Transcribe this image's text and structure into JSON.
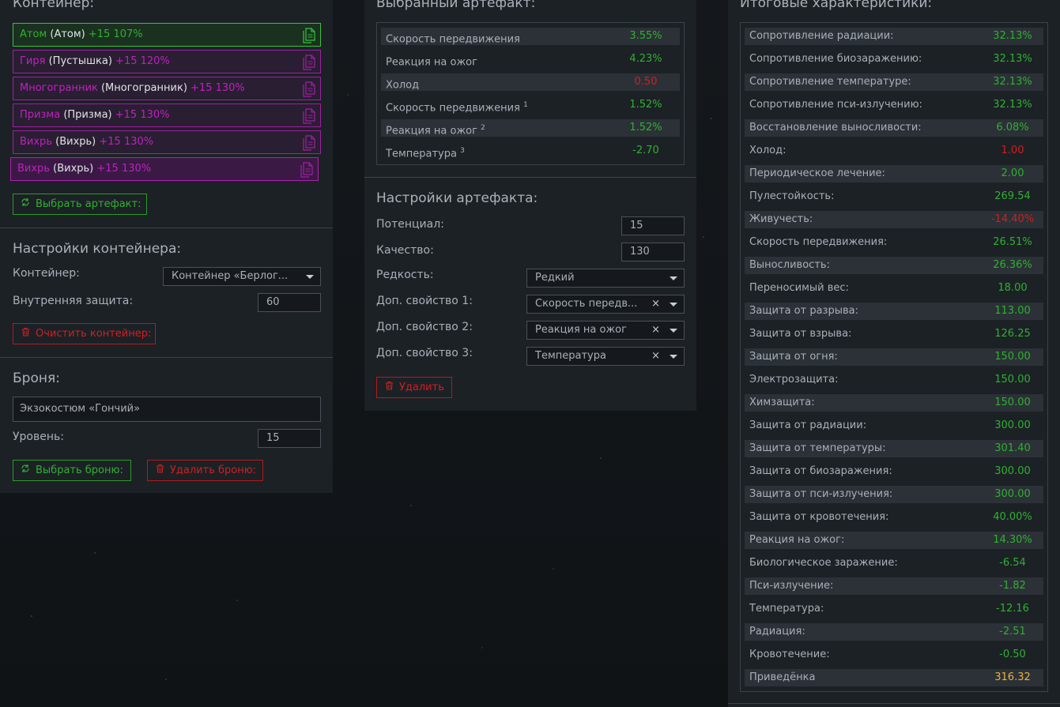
{
  "container_panel": {
    "title": "Контейнер:",
    "slots": [
      {
        "name": "Атом",
        "alias": "(Атом)",
        "bonus": "+15 107%",
        "rarity": "common"
      },
      {
        "name": "Гиря",
        "alias": "(Пустышка)",
        "bonus": "+15 120%",
        "rarity": "rare"
      },
      {
        "name": "Многогранник",
        "alias": "(Многогранник)",
        "bonus": "+15 130%",
        "rarity": "rare"
      },
      {
        "name": "Призма",
        "alias": "(Призма)",
        "bonus": "+15 130%",
        "rarity": "rare"
      },
      {
        "name": "Вихрь",
        "alias": "(Вихрь)",
        "bonus": "+15 130%",
        "rarity": "rare"
      },
      {
        "name": "Вихрь",
        "alias": "(Вихрь)",
        "bonus": "+15 130%",
        "rarity": "rare2"
      }
    ],
    "select_artifact_label": "Выбрать артефакт:"
  },
  "container_settings": {
    "title": "Настройки контейнера:",
    "container_label": "Контейнер:",
    "container_value": "Контейнер «Берлог...",
    "inner_protection_label": "Внутренняя защита:",
    "inner_protection_value": "60",
    "clear_label": "Очистить контейнер:"
  },
  "armor": {
    "title": "Броня:",
    "armor_value": "Экзокостюм «Гончий»",
    "level_label": "Уровень:",
    "level_value": "15",
    "select_label": "Выбрать броню:",
    "delete_label": "Удалить броню:"
  },
  "selected_artifact": {
    "title": "Выбранный артефакт:",
    "stats": [
      {
        "name": "Скорость передвижения",
        "sup": "",
        "value": "3.55%",
        "color": "green"
      },
      {
        "name": "Реакция на ожог",
        "sup": "",
        "value": "4.23%",
        "color": "green"
      },
      {
        "name": "Холод",
        "sup": "",
        "value": "0.50",
        "color": "red"
      },
      {
        "name": "Скорость передвижения ",
        "sup": "1",
        "value": "1.52%",
        "color": "green"
      },
      {
        "name": "Реакция на ожог ",
        "sup": "2",
        "value": "1.52%",
        "color": "green"
      },
      {
        "name": "Температура ",
        "sup": "3",
        "value": "-2.70",
        "color": "green"
      }
    ]
  },
  "artifact_settings": {
    "title": "Настройки артефакта:",
    "potential_label": "Потенциал:",
    "potential_value": "15",
    "quality_label": "Качество:",
    "quality_value": "130",
    "rarity_label": "Редкость:",
    "rarity_value": "Редкий",
    "prop1_label": "Доп. свойство 1:",
    "prop1_value": "Скорость передв...",
    "prop2_label": "Доп. свойство 2:",
    "prop2_value": "Реакция на ожог",
    "prop3_label": "Доп. свойство 3:",
    "prop3_value": "Температура",
    "clear_glyph": "×",
    "delete_label": "Удалить"
  },
  "totals": {
    "title": "Итоговые характеристики:",
    "stats": [
      {
        "name": "Сопротивление радиации:",
        "value": "32.13%",
        "color": "green"
      },
      {
        "name": "Сопротивление биозаражению:",
        "value": "32.13%",
        "color": "green"
      },
      {
        "name": "Сопротивление температуре:",
        "value": "32.13%",
        "color": "green"
      },
      {
        "name": "Сопротивление пси-излучению:",
        "value": "32.13%",
        "color": "green"
      },
      {
        "name": "Восстановление выносливости:",
        "value": "6.08%",
        "color": "green"
      },
      {
        "name": "Холод:",
        "value": "1.00",
        "color": "red"
      },
      {
        "name": "Периодическое лечение:",
        "value": "2.00",
        "color": "green"
      },
      {
        "name": "Пулестойкость:",
        "value": "269.54",
        "color": "green"
      },
      {
        "name": "Живучесть:",
        "value": "-14.40%",
        "color": "red"
      },
      {
        "name": "Скорость передвижения:",
        "value": "26.51%",
        "color": "green"
      },
      {
        "name": "Выносливость:",
        "value": "26.36%",
        "color": "green"
      },
      {
        "name": "Переносимый вес:",
        "value": "18.00",
        "color": "green"
      },
      {
        "name": "Защита от разрыва:",
        "value": "113.00",
        "color": "green"
      },
      {
        "name": "Защита от взрыва:",
        "value": "126.25",
        "color": "green"
      },
      {
        "name": "Защита от огня:",
        "value": "150.00",
        "color": "green"
      },
      {
        "name": "Электрозащита:",
        "value": "150.00",
        "color": "green"
      },
      {
        "name": "Химзащита:",
        "value": "150.00",
        "color": "green"
      },
      {
        "name": "Защита от радиации:",
        "value": "300.00",
        "color": "green"
      },
      {
        "name": "Защита от температуры:",
        "value": "301.40",
        "color": "green"
      },
      {
        "name": "Защита от биозаражения:",
        "value": "300.00",
        "color": "green"
      },
      {
        "name": "Защита от пси-излучения:",
        "value": "300.00",
        "color": "green"
      },
      {
        "name": "Защита от кровотечения:",
        "value": "40.00%",
        "color": "green"
      },
      {
        "name": "Реакция на ожог:",
        "value": "14.30%",
        "color": "green"
      },
      {
        "name": "Биологическое заражение:",
        "value": "-6.54",
        "color": "green"
      },
      {
        "name": "Пси-излучение:",
        "value": "-1.82",
        "color": "green"
      },
      {
        "name": "Температура:",
        "value": "-12.16",
        "color": "green"
      },
      {
        "name": "Радиация:",
        "value": "-2.51",
        "color": "green"
      },
      {
        "name": "Кровотечение:",
        "value": "-0.50",
        "color": "green"
      },
      {
        "name": "Приведёнка",
        "value": "316.32",
        "color": "gold"
      }
    ]
  },
  "colors": {
    "green": "#2fb12f",
    "red": "#d11f1f",
    "purple": "#c020c0",
    "gold": "#e8b43a",
    "panel": "#1c2126"
  },
  "icons": {
    "slot": "document-copy-icon",
    "select": "refresh-icon",
    "delete": "trash-icon"
  }
}
